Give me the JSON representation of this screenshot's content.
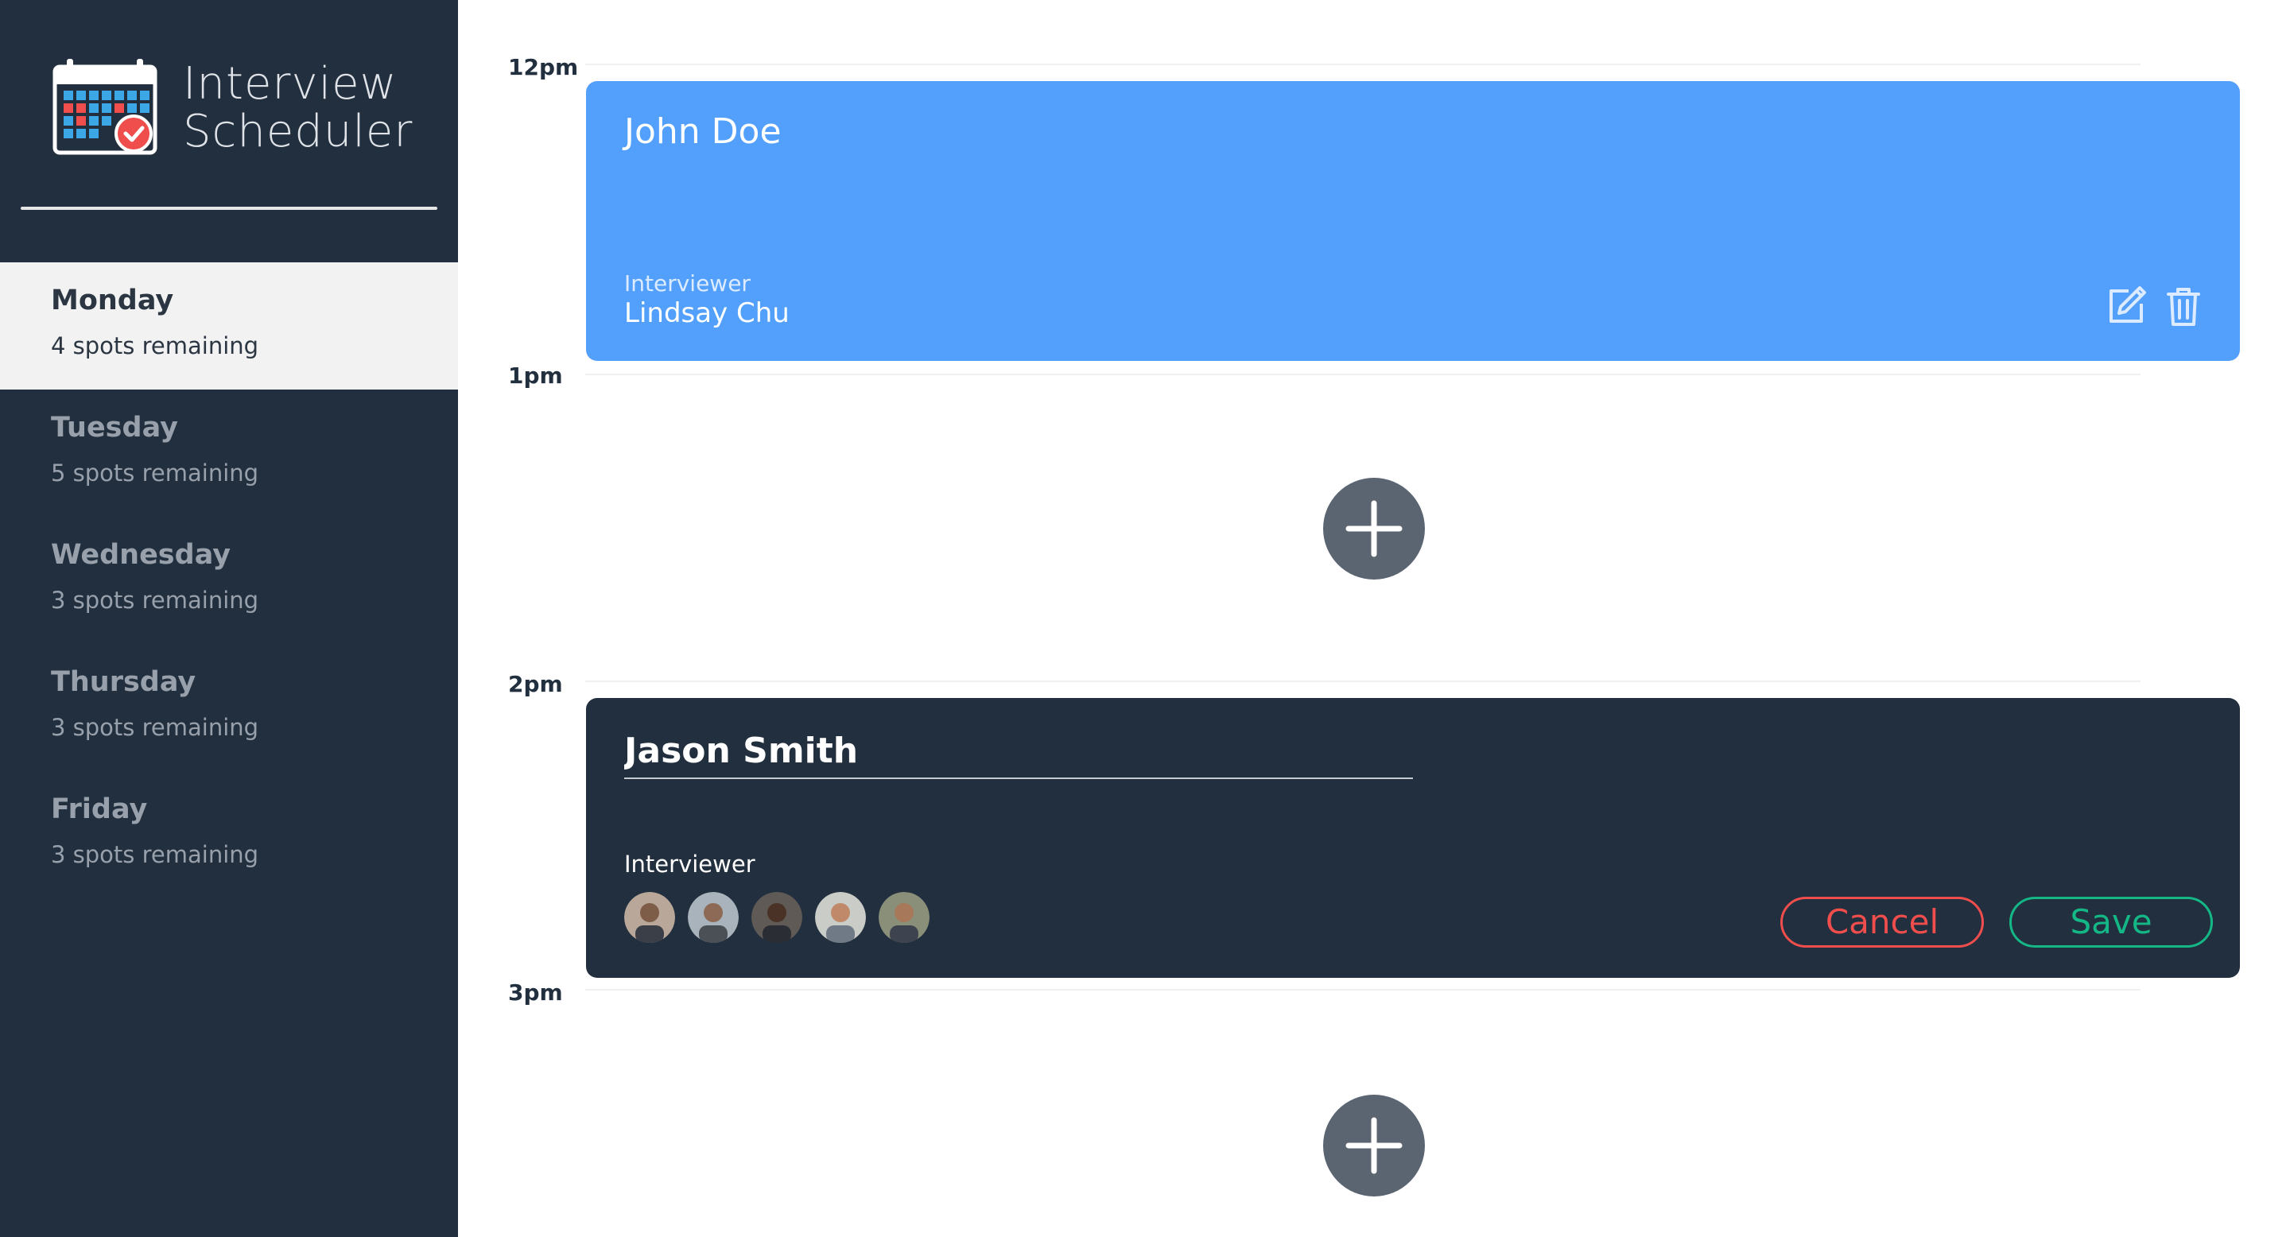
{
  "app": {
    "title_line1": "Interview",
    "title_line2": "Scheduler"
  },
  "sidebar": {
    "days": [
      {
        "name": "Monday",
        "spots": "4 spots remaining",
        "selected": true
      },
      {
        "name": "Tuesday",
        "spots": "5 spots remaining",
        "selected": false
      },
      {
        "name": "Wednesday",
        "spots": "3 spots remaining",
        "selected": false
      },
      {
        "name": "Thursday",
        "spots": "3 spots remaining",
        "selected": false
      },
      {
        "name": "Friday",
        "spots": "3 spots remaining",
        "selected": false
      }
    ]
  },
  "schedule": {
    "hours": [
      "12pm",
      "1pm",
      "2pm",
      "3pm"
    ],
    "appointment_show": {
      "student": "John Doe",
      "interviewer_label": "Interviewer",
      "interviewer_name": "Lindsay Chu",
      "edit_icon": "edit-icon",
      "delete_icon": "trash-icon"
    },
    "appointment_form": {
      "student_value": "Jason Smith",
      "interviewer_label": "Interviewer",
      "cancel_label": "Cancel",
      "save_label": "Save",
      "avatars": [
        "interviewer-avatar",
        "interviewer-avatar",
        "interviewer-avatar",
        "interviewer-avatar",
        "interviewer-avatar"
      ]
    },
    "add_icon": "plus-icon"
  },
  "colors": {
    "sidebar_bg": "#222f3e",
    "show_card": "#52a0fc",
    "form_card": "#222f3e",
    "cancel": "#f04d4d",
    "save": "#14b886",
    "add_button": "#5b6571"
  }
}
